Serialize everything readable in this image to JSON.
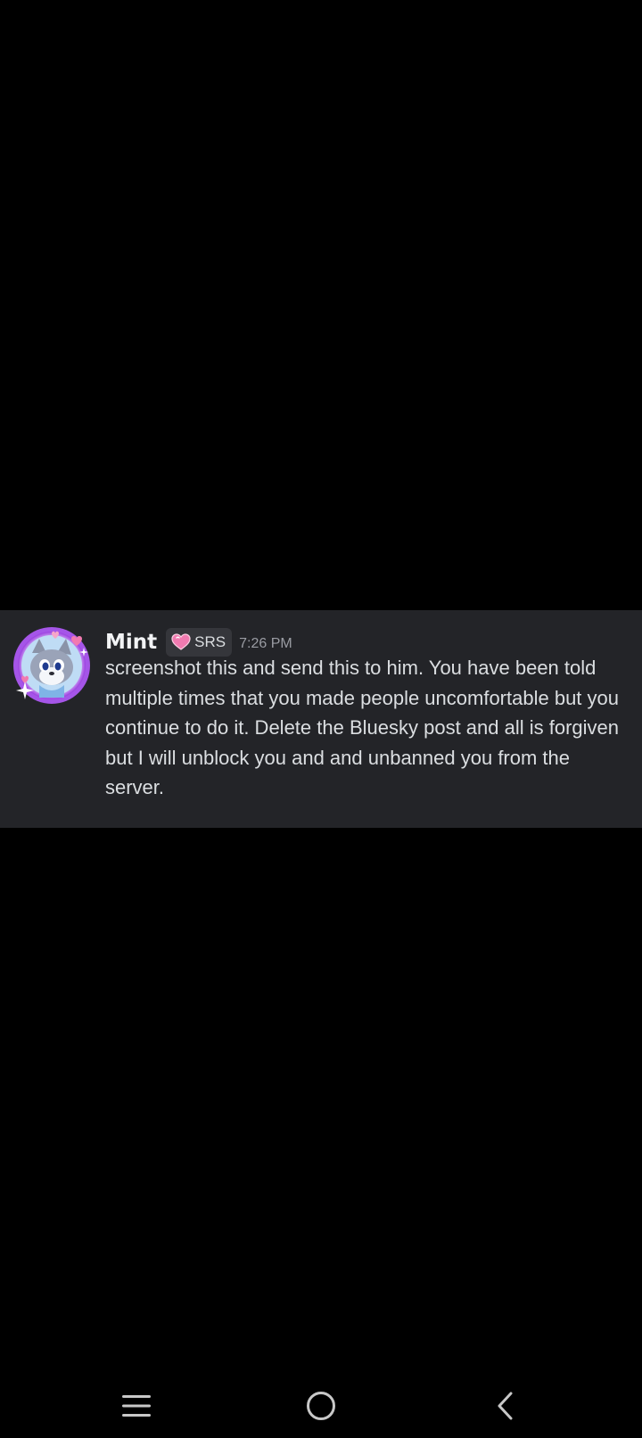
{
  "message": {
    "username": "Mint",
    "tag_label": "SRS",
    "tag_icon": "pink-heart-icon",
    "timestamp": "7:26 PM",
    "text": "screenshot this and send this to him. You have been told multiple times that you made people uncomfortable but you continue to do it. Delete the Bluesky post and all is forgiven but I will unblock you and and unbanned you from the server.",
    "avatar": "cartoon-wolf-avatar-icon"
  },
  "nav_bar": {
    "recents_icon": "recents-icon",
    "home_icon": "home-icon",
    "back_icon": "back-icon"
  },
  "colors": {
    "background": "#000000",
    "card": "#232428",
    "username": "#f2f3f5",
    "message_text": "#dbdee1",
    "timestamp": "#9a9ca3",
    "tag_bg": "#35363b",
    "avatar_ring": "#a555e8",
    "heart": "#f17ab0"
  }
}
